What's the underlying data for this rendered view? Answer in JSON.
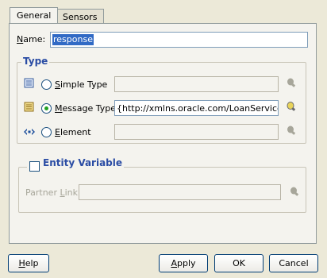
{
  "tabs": [
    {
      "label": "General"
    },
    {
      "label": "Sensors"
    }
  ],
  "name": {
    "label": "Name:",
    "value": "response"
  },
  "type_group": {
    "legend": "Type",
    "options": [
      {
        "label": "Simple Type",
        "selected": false,
        "value": ""
      },
      {
        "label": "Message Type",
        "selected": true,
        "value": "{http://xmlns.oracle.com/LoanService}Loa"
      },
      {
        "label": "Element",
        "selected": false,
        "value": ""
      }
    ]
  },
  "entity_variable": {
    "legend": "Entity Variable",
    "checked": false,
    "partner_link_label": "Partner Link:",
    "partner_link_value": ""
  },
  "buttons": {
    "help": "Help",
    "apply": "Apply",
    "ok": "OK",
    "cancel": "Cancel"
  },
  "colors": {
    "legend": "#2a4ca4",
    "selection": "#316ac5",
    "radio_dot": "#21a121"
  }
}
